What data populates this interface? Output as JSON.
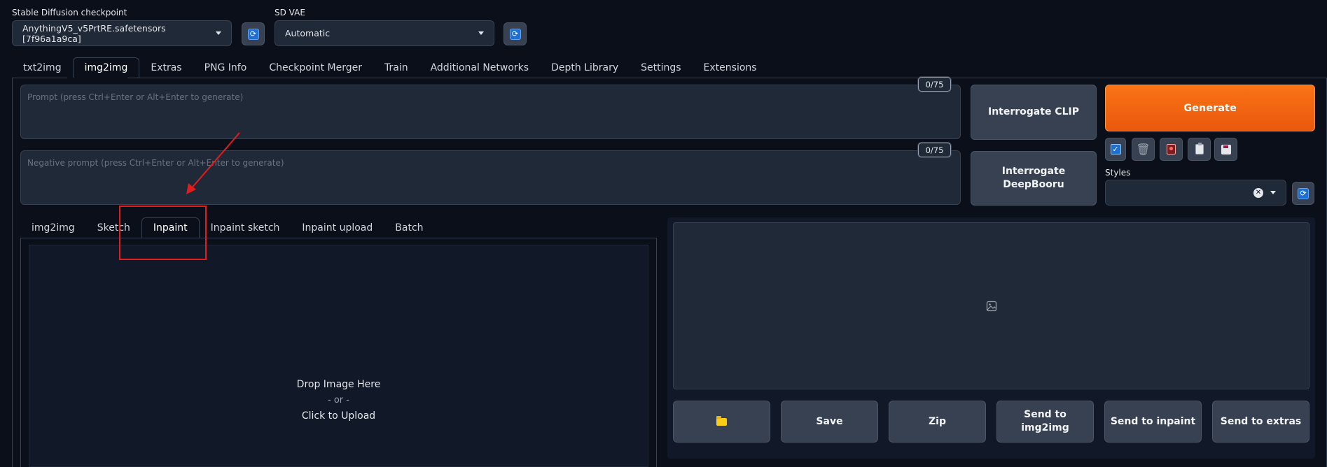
{
  "top": {
    "checkpoint": {
      "label": "Stable Diffusion checkpoint",
      "value": "AnythingV5_v5PrtRE.safetensors [7f96a1a9ca]"
    },
    "vae": {
      "label": "SD VAE",
      "value": "Automatic"
    }
  },
  "main_tabs": [
    {
      "label": "txt2img"
    },
    {
      "label": "img2img"
    },
    {
      "label": "Extras"
    },
    {
      "label": "PNG Info"
    },
    {
      "label": "Checkpoint Merger"
    },
    {
      "label": "Train"
    },
    {
      "label": "Additional Networks"
    },
    {
      "label": "Depth Library"
    },
    {
      "label": "Settings"
    },
    {
      "label": "Extensions"
    }
  ],
  "active_main_tab": "img2img",
  "prompt": {
    "placeholder": "Prompt (press Ctrl+Enter or Alt+Enter to generate)",
    "counter": "0/75"
  },
  "negative_prompt": {
    "placeholder": "Negative prompt (press Ctrl+Enter or Alt+Enter to generate)",
    "counter": "0/75"
  },
  "buttons": {
    "interrogate_clip": "Interrogate CLIP",
    "interrogate_deepbooru": "Interrogate DeepBooru",
    "generate": "Generate"
  },
  "styles": {
    "label": "Styles"
  },
  "sub_tabs": [
    {
      "label": "img2img"
    },
    {
      "label": "Sketch"
    },
    {
      "label": "Inpaint"
    },
    {
      "label": "Inpaint sketch"
    },
    {
      "label": "Inpaint upload"
    },
    {
      "label": "Batch"
    }
  ],
  "active_sub_tab": "Inpaint",
  "upload": {
    "line1": "Drop Image Here",
    "line2": "- or -",
    "line3": "Click to Upload"
  },
  "output_buttons": {
    "save": "Save",
    "zip": "Zip",
    "send_img2img": "Send to img2img",
    "send_inpaint": "Send to inpaint",
    "send_extras": "Send to extras"
  },
  "colors": {
    "accent": "#f97316",
    "annotation": "#e11d1d",
    "refresh": "#1d6fd1"
  }
}
